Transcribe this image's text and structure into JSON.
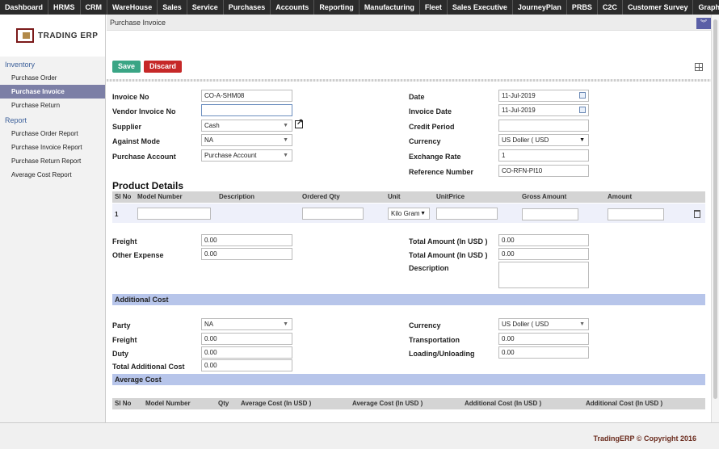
{
  "topnav": [
    "Dashboard",
    "HRMS",
    "CRM",
    "WareHouse",
    "Sales",
    "Service",
    "Purchases",
    "Accounts",
    "Reporting",
    "Manufacturing",
    "Fleet",
    "Sales Executive",
    "JourneyPlan",
    "PRBS",
    "C2C",
    "Customer Survey",
    "Graph"
  ],
  "logo_text": "TRADING ERP",
  "sidebar": {
    "section1": "Inventory",
    "items1": [
      "Purchase Order",
      "Purchase Invoice",
      "Purchase Return"
    ],
    "section2": "Report",
    "items2": [
      "Purchase Order Report",
      "Purchase Invoice Report",
      "Purchase Return Report",
      "Average Cost Report"
    ]
  },
  "page_title": "Purchase Invoice",
  "collapse_icon": "chevrons-down-icon",
  "toolbar": {
    "save": "Save",
    "discard": "Discard"
  },
  "form": {
    "invoice_no_label": "Invoice No",
    "invoice_no": "CO-A-SHM08",
    "vendor_invoice_label": "Vendor Invoice No",
    "vendor_invoice": "",
    "supplier_label": "Supplier",
    "supplier": "Cash",
    "against_mode_label": "Against Mode",
    "against_mode": "NA",
    "purchase_account_label": "Purchase Account",
    "purchase_account": "Purchase Account",
    "date_label": "Date",
    "date": "11-Jul-2019",
    "invoice_date_label": "Invoice Date",
    "invoice_date": "11-Jul-2019",
    "credit_period_label": "Credit Period",
    "credit_period": "",
    "currency_label": "Currency",
    "currency": "US Doller ( USD",
    "exchange_rate_label": "Exchange Rate",
    "exchange_rate": "1",
    "reference_label": "Reference Number",
    "reference": "CO-RFN-PI10"
  },
  "product": {
    "title": "Product Details",
    "headers": [
      "Sl No",
      "Model Number",
      "Description",
      "Ordered Qty",
      "Unit",
      "UnitPrice",
      "Gross Amount",
      "Amount"
    ],
    "row": {
      "sl": "1",
      "unit": "Kilo Gram"
    }
  },
  "totals": {
    "freight_label": "Freight",
    "freight": "0.00",
    "other_expense_label": "Other Expense",
    "other_expense": "0.00",
    "total_amount_label": "Total Amount (In USD )",
    "total_amount_1": "0.00",
    "total_amount_2": "0.00",
    "description_label": "Description"
  },
  "additional_cost": {
    "title": "Additional Cost",
    "party_label": "Party",
    "party": "NA",
    "freight_label": "Freight",
    "freight": "0.00",
    "duty_label": "Duty",
    "duty": "0.00",
    "total_label": "Total Additional Cost",
    "total": "0.00",
    "currency_label": "Currency",
    "currency": "US Doller ( USD",
    "transportation_label": "Transportation",
    "transportation": "0.00",
    "loading_label": "Loading/Unloading",
    "loading": "0.00"
  },
  "average_cost": {
    "title": "Average Cost",
    "headers": [
      "Sl No",
      "Model Number",
      "Qty",
      "Average Cost (In USD )",
      "Average Cost (In USD )",
      "Additional Cost (In USD )",
      "Additional Cost (In USD )"
    ]
  },
  "footer": "TradingERP © Copyright 2016"
}
